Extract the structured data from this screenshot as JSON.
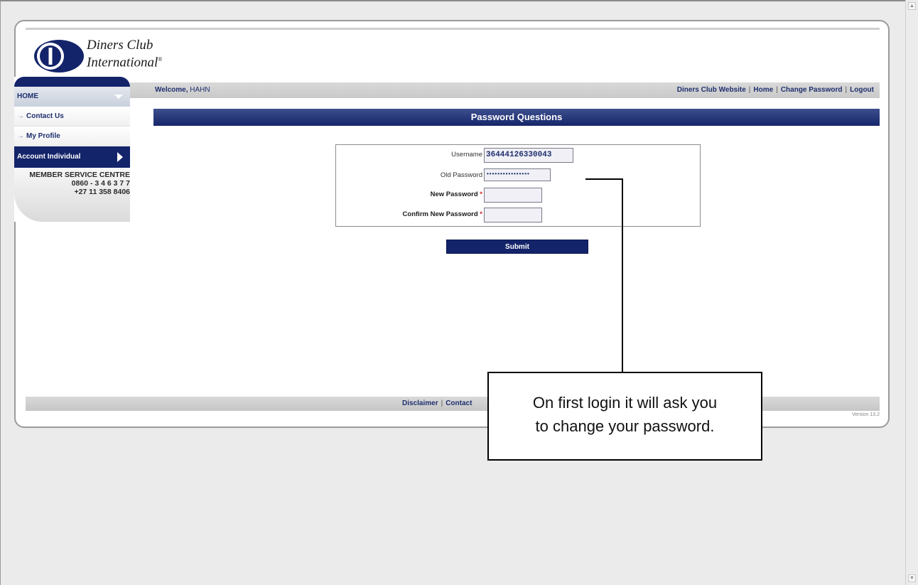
{
  "brand": {
    "name_line1": "Diners Club",
    "name_line2": "International",
    "trademark": "®"
  },
  "header": {
    "welcome_label": "Welcome,",
    "username_display": "HAHN",
    "links": [
      "Diners Club Website",
      "Home",
      "Change Password",
      "Logout"
    ],
    "separator": "|"
  },
  "sidebar": {
    "home_label": "HOME",
    "items": [
      {
        "label": "Contact Us"
      },
      {
        "label": "My Profile"
      }
    ],
    "active_item": "Account Individual",
    "service_centre": {
      "title": "MEMBER SERVICE CENTRE",
      "phone_local": "0860 - 3 4 6 3 7 7",
      "phone_intl": "+27 11 358 8406"
    }
  },
  "main": {
    "title": "Password Questions",
    "form": {
      "username_label": "Username",
      "username_value": "36444126330043",
      "old_password_label": "Old Password",
      "old_password_value": "••••••••••••••••",
      "new_password_label": "New Password",
      "confirm_password_label": "Confirm New Password",
      "required_marker": "*",
      "submit_label": "Submit"
    }
  },
  "footer": {
    "links": [
      "Disclaimer",
      "Contact"
    ],
    "separator": "|",
    "version": "Version 13.2"
  },
  "callout": {
    "line1": "On first login it will ask you",
    "line2": "to change your password."
  }
}
